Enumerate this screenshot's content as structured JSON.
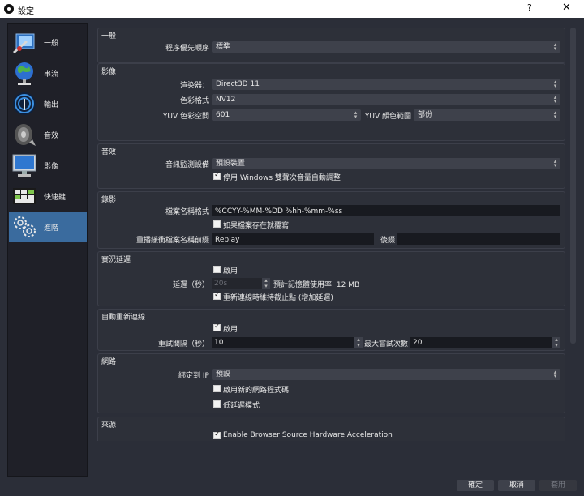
{
  "window": {
    "title": "設定",
    "help_label": "?",
    "close_label": "✕"
  },
  "sidebar": {
    "items": [
      {
        "label": "一般",
        "icon": "general-settings-icon"
      },
      {
        "label": "串流",
        "icon": "stream-globe-icon"
      },
      {
        "label": "輸出",
        "icon": "output-broadcast-icon"
      },
      {
        "label": "音效",
        "icon": "audio-speaker-icon"
      },
      {
        "label": "影像",
        "icon": "video-monitor-icon"
      },
      {
        "label": "快速鍵",
        "icon": "hotkeys-keyboard-icon"
      },
      {
        "label": "進階",
        "icon": "advanced-gears-icon"
      }
    ],
    "active_index": 6
  },
  "general": {
    "title": "一般",
    "priority_label": "程序優先順序",
    "priority_value": "標準"
  },
  "video": {
    "title": "影像",
    "renderer_label": "渲染器：",
    "renderer_value": "Direct3D 11",
    "color_format_label": "色彩格式",
    "color_format_value": "NV12",
    "yuv_space_label": "YUV 色彩空間",
    "yuv_space_value": "601",
    "yuv_range_label": "YUV 顏色範圍",
    "yuv_range_value": "部份"
  },
  "audio": {
    "title": "音效",
    "monitor_label": "音訊監測設備",
    "monitor_value": "預設裝置",
    "ducking_label": "停用 Windows 雙聲次音量自動調整",
    "ducking_checked": true
  },
  "recording": {
    "title": "錄影",
    "filename_label": "檔案名稱格式",
    "filename_value": "%CCYY-%MM-%DD %hh-%mm-%ss",
    "overwrite_label": "如果檔案存在就覆寫",
    "overwrite_checked": false,
    "replay_prefix_label": "重播緩衝檔案名稱前綴",
    "replay_prefix_value": "Replay",
    "suffix_label": "後綴",
    "suffix_value": ""
  },
  "stream_delay": {
    "title": "實況延遲",
    "enable_label": "啟用",
    "enable_checked": false,
    "delay_label": "延遲（秒）",
    "delay_value": "20s",
    "memory_label": "預計記憶體使用率: 12 MB",
    "preserve_label": "重新連線時維持截止點 (增加延遲)",
    "preserve_checked": true
  },
  "reconnect": {
    "title": "自動重新連線",
    "enable_label": "啟用",
    "enable_checked": true,
    "retry_delay_label": "重試間隔（秒）",
    "retry_delay_value": "10",
    "max_retries_label": "最大嘗試次數",
    "max_retries_value": "20"
  },
  "network": {
    "title": "網路",
    "bind_ip_label": "綁定到 IP",
    "bind_ip_value": "預設",
    "new_code_label": "啟用新的網路程式碼",
    "new_code_checked": false,
    "low_latency_label": "低延遲模式",
    "low_latency_checked": false
  },
  "sources": {
    "title": "來源",
    "hw_accel_label": "Enable Browser Source Hardware Acceleration",
    "hw_accel_checked": true
  },
  "footer": {
    "ok_label": "確定",
    "cancel_label": "取消",
    "apply_label": "套用"
  }
}
